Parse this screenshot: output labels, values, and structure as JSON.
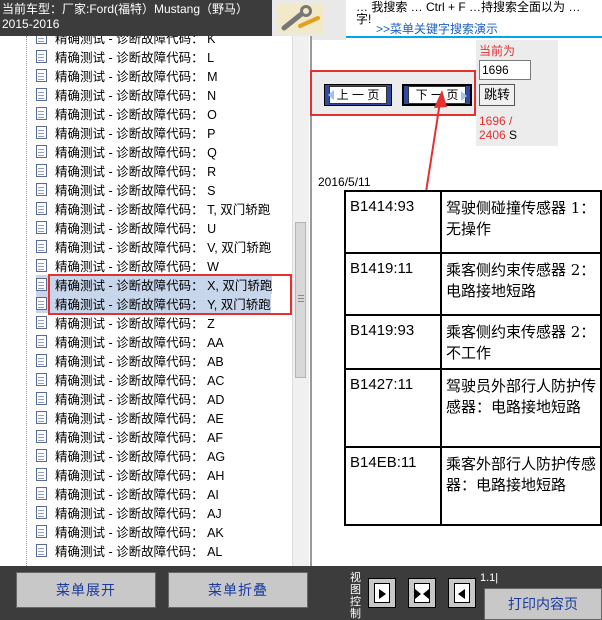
{
  "header": {
    "vehicle_line": "当前车型：厂家:Ford(福特）Mustang（野马）",
    "year_line": "2015-2016"
  },
  "banner": {
    "line1": "… 我搜索 … Ctrl + F …持搜索全面以为 …",
    "line2": "字!",
    "link": ">>菜单关键字搜索演示"
  },
  "tree": {
    "items": [
      {
        "label": "精确测试 - 诊断故障代码： K"
      },
      {
        "label": "精确测试 - 诊断故障代码： L"
      },
      {
        "label": "精确测试 - 诊断故障代码： M"
      },
      {
        "label": "精确测试 - 诊断故障代码： N"
      },
      {
        "label": "精确测试 - 诊断故障代码： O"
      },
      {
        "label": "精确测试 - 诊断故障代码： P"
      },
      {
        "label": "精确测试 - 诊断故障代码： Q"
      },
      {
        "label": "精确测试 - 诊断故障代码： R"
      },
      {
        "label": "精确测试 - 诊断故障代码： S"
      },
      {
        "label": "精确测试 - 诊断故障代码： T, 双门轿跑"
      },
      {
        "label": "精确测试 - 诊断故障代码： U"
      },
      {
        "label": "精确测试 - 诊断故障代码： V, 双门轿跑"
      },
      {
        "label": "精确测试 - 诊断故障代码： W"
      },
      {
        "label": "精确测试 - 诊断故障代码： X, 双门轿跑"
      },
      {
        "label": "精确测试 - 诊断故障代码： Y, 双门轿跑"
      },
      {
        "label": "精确测试 - 诊断故障代码： Z"
      },
      {
        "label": "精确测试 - 诊断故障代码： AA"
      },
      {
        "label": "精确测试 - 诊断故障代码： AB"
      },
      {
        "label": "精确测试 - 诊断故障代码： AC"
      },
      {
        "label": "精确测试 - 诊断故障代码： AD"
      },
      {
        "label": "精确测试 - 诊断故障代码： AE"
      },
      {
        "label": "精确测试 - 诊断故障代码： AF"
      },
      {
        "label": "精确测试 - 诊断故障代码： AG"
      },
      {
        "label": "精确测试 - 诊断故障代码： AH"
      },
      {
        "label": "精确测试 - 诊断故障代码： AI"
      },
      {
        "label": "精确测试 - 诊断故障代码： AJ"
      },
      {
        "label": "精确测试 - 诊断故障代码： AK"
      },
      {
        "label": "精确测试 - 诊断故障代码： AL"
      }
    ]
  },
  "nav": {
    "prev_label": "上 一 页",
    "next_label": "下 一 页",
    "current_label": "当前为",
    "page_value": "1696",
    "go_label": "跳转",
    "page_count": "1696 /",
    "total_pages": "2406",
    "suffix": "S"
  },
  "doc": {
    "date": "2016/5/11",
    "rows": [
      {
        "code": "B1414:93",
        "desc": "驾驶侧碰撞传感器 1：无操作"
      },
      {
        "code": "B1419:11",
        "desc": "乘客侧约束传感器 2：电路接地短路"
      },
      {
        "code": "B1419:93",
        "desc": "乘客侧约束传感器 2：不工作"
      },
      {
        "code": "B1427:11",
        "desc": "驾驶员外部行人防护传感器：电路接地短路"
      },
      {
        "code": "B14EB:11",
        "desc": "乘客外部行人防护传感器：电路接地短路"
      }
    ]
  },
  "bottom": {
    "expand_label": "菜单展开",
    "collapse_label": "菜单折叠",
    "view_label": "视图控制",
    "zoom_text": "1.1|",
    "print_label": "打印内容页"
  },
  "colors": {
    "highlight_red": "#e53030",
    "nav_blue": "#2f4aa0",
    "dark_bg": "#3c3c3c"
  }
}
